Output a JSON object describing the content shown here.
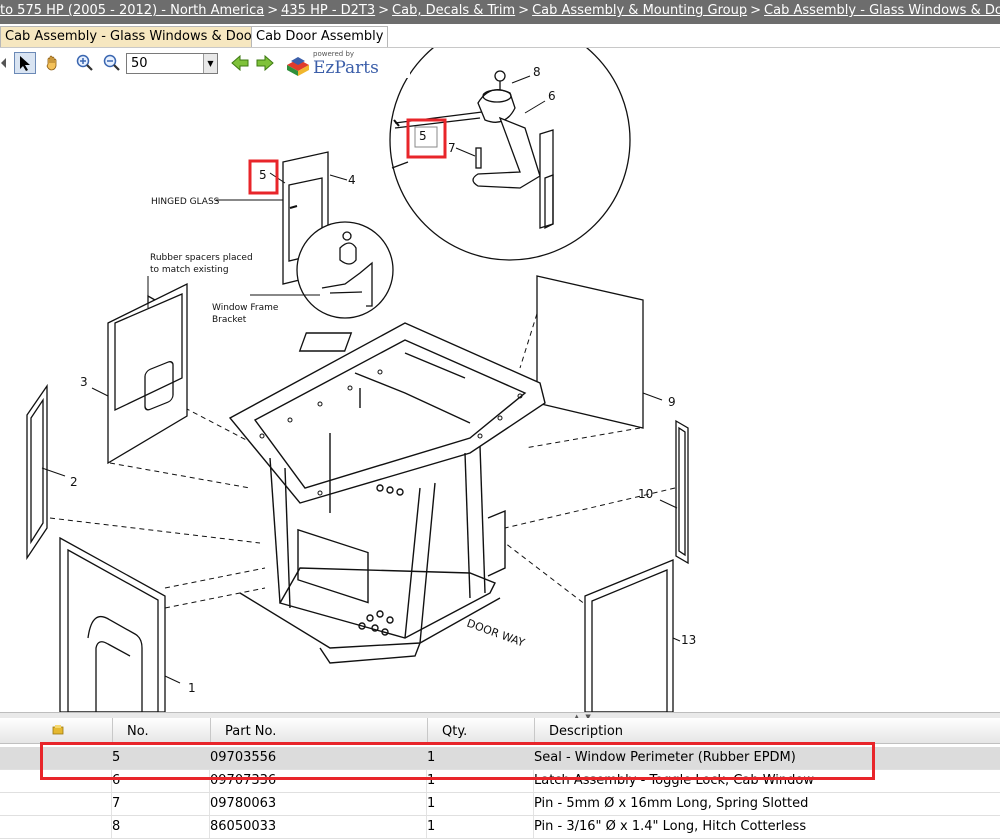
{
  "breadcrumb": [
    {
      "label": "to 575 HP (2005 - 2012) - North America"
    },
    {
      "label": "435 HP - D2T3"
    },
    {
      "label": "Cab, Decals & Trim"
    },
    {
      "label": "Cab Assembly & Mounting Group"
    },
    {
      "label": "Cab Assembly - Glass Windows & Door"
    }
  ],
  "breadcrumb_separator": ">",
  "tabs": [
    {
      "label": "Cab Assembly - Glass Windows & Door",
      "active": true
    },
    {
      "label": "Cab Door Assembly",
      "active": false
    }
  ],
  "toolbar": {
    "zoom_value": "50",
    "logo_powered": "powered by",
    "logo_name": "EzParts"
  },
  "diagram": {
    "callouts": {
      "c1": "1",
      "c2": "2",
      "c3": "3",
      "c4": "4",
      "c5": "5",
      "c5_zoom": "5",
      "c6": "6",
      "c7": "7",
      "c8": "8",
      "c9": "9",
      "c10": "10",
      "c13": "13"
    },
    "labels": {
      "hinged_glass": "HINGED GLASS",
      "rubber_spacers_1": "Rubber spacers placed",
      "rubber_spacers_2": "to match existing",
      "window_frame_1": "Window Frame",
      "window_frame_2": "Bracket",
      "door_way": "DOOR WAY"
    }
  },
  "parts_table": {
    "columns": {
      "no": "No.",
      "part_no": "Part No.",
      "qty": "Qty.",
      "description": "Description"
    },
    "rows": [
      {
        "no": "5",
        "part_no": "09703556",
        "qty": "1",
        "description": "Seal - Window Perimeter (Rubber EPDM)",
        "selected": true
      },
      {
        "no": "6",
        "part_no": "09707336",
        "qty": "1",
        "description": "Latch Assembly - Toggle Lock, Cab Window",
        "selected": false
      },
      {
        "no": "7",
        "part_no": "09780063",
        "qty": "1",
        "description": "Pin - 5mm Ø x 16mm Long, Spring Slotted",
        "selected": false
      },
      {
        "no": "8",
        "part_no": "86050033",
        "qty": "1",
        "description": "Pin - 3/16\" Ø x 1.4\" Long, Hitch Cotterless",
        "selected": false
      }
    ]
  },
  "colors": {
    "breadcrumb_bg": "#6d6d6d",
    "active_tab": "#f6e7c0",
    "highlight_red": "#e8252a",
    "selected_row": "#dcdcdc"
  }
}
